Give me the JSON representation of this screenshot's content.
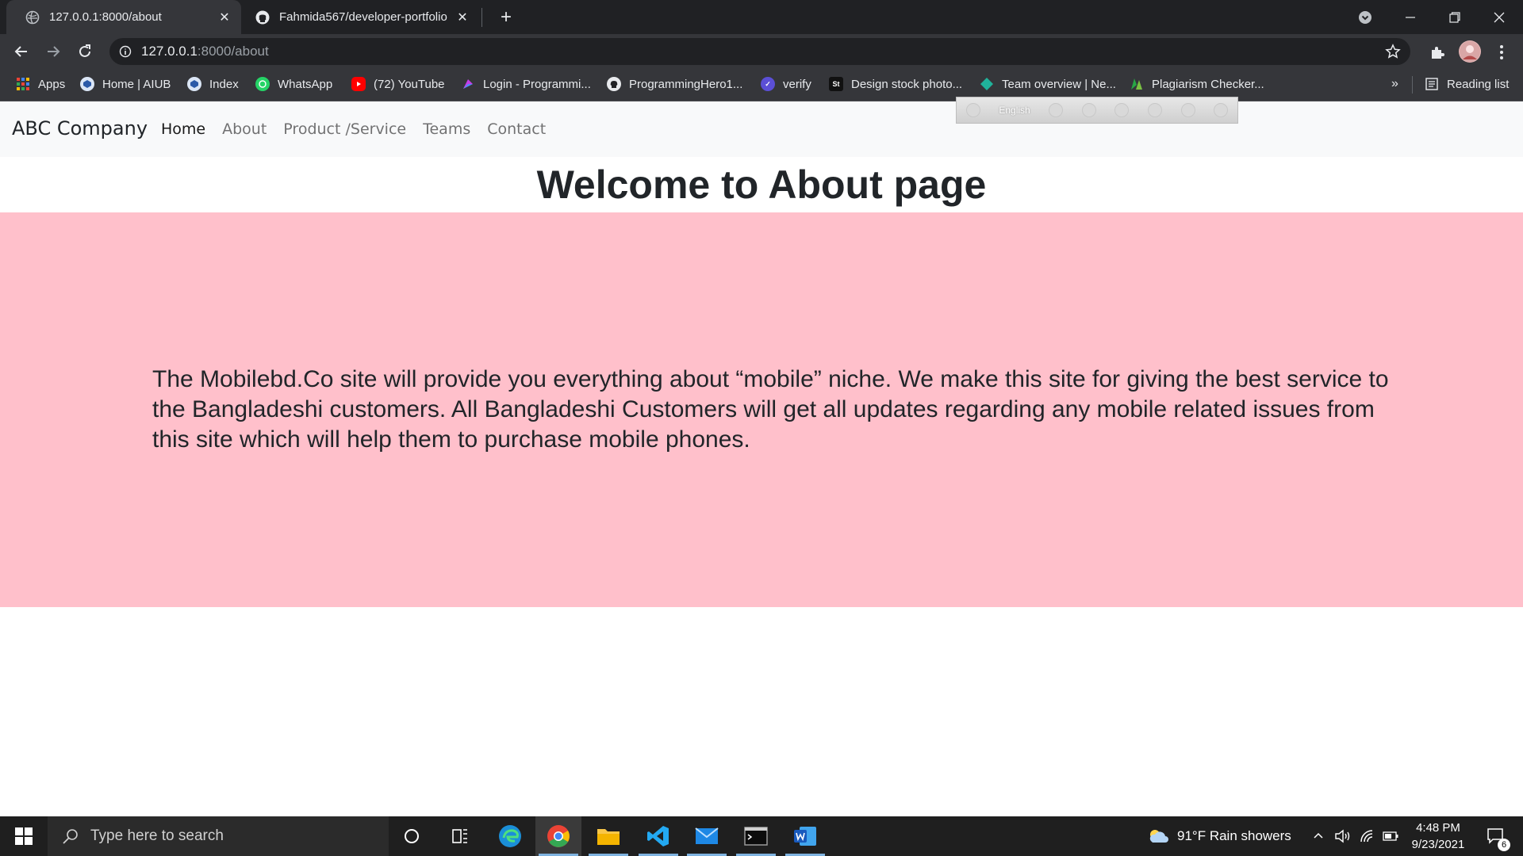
{
  "browser": {
    "tabs": [
      {
        "title": "127.0.0.1:8000/about",
        "active": true
      },
      {
        "title": "Fahmida567/developer-portfolio",
        "active": false
      }
    ],
    "address": {
      "host": "127.0.0.1",
      "path": ":8000/about"
    },
    "bookmarks": [
      {
        "label": "Apps",
        "icon": "apps-grid-icon"
      },
      {
        "label": "Home | AIUB",
        "icon": "aiub-icon"
      },
      {
        "label": "Index",
        "icon": "aiub-icon"
      },
      {
        "label": "WhatsApp",
        "icon": "whatsapp-icon"
      },
      {
        "label": "(72) YouTube",
        "icon": "youtube-icon"
      },
      {
        "label": "Login - Programmi...",
        "icon": "programming-hero-icon"
      },
      {
        "label": "ProgrammingHero1...",
        "icon": "github-icon"
      },
      {
        "label": "verify",
        "icon": "verify-icon"
      },
      {
        "label": "Design stock photo...",
        "icon": "shutterstock-icon"
      },
      {
        "label": "Team overview | Ne...",
        "icon": "netlify-icon"
      },
      {
        "label": "Plagiarism Checker...",
        "icon": "plagiarism-icon"
      }
    ],
    "bookmarks_more": "»",
    "reading_list": "Reading list"
  },
  "page": {
    "brand": "ABC Company",
    "nav": [
      "Home",
      "About",
      "Product /Service",
      "Teams",
      "Contact"
    ],
    "ime_language": "English",
    "heading": "Welcome to About page",
    "body_text": "The Mobilebd.Co site will provide you everything about “mobile” niche. We make this site for giving the best service to the Bangladeshi customers. All Bangladeshi Customers will get all updates regarding any mobile related issues from this site which will help them to purchase mobile phones.",
    "colors": {
      "content_bg": "#ffc0cb",
      "navbar_bg": "#f8f9fa"
    }
  },
  "taskbar": {
    "search_placeholder": "Type here to search",
    "weather": "91°F  Rain showers",
    "time": "4:48 PM",
    "date": "9/23/2021",
    "notifications": "6"
  }
}
